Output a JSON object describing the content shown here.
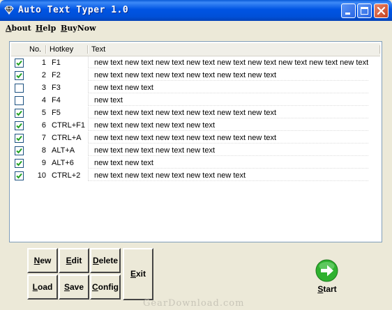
{
  "window": {
    "title": "Auto Text Typer 1.0"
  },
  "menu": [
    {
      "label": "About"
    },
    {
      "label": "Help"
    },
    {
      "label": "BuyNow"
    }
  ],
  "table": {
    "headers": {
      "no": "No.",
      "hotkey": "Hotkey",
      "text": "Text"
    },
    "rows": [
      {
        "checked": true,
        "no": "1",
        "hotkey": "F1",
        "text": "new text new text new text new text new text new text new text new text new text"
      },
      {
        "checked": true,
        "no": "2",
        "hotkey": "F2",
        "text": "new text new text new text new text new text new text"
      },
      {
        "checked": false,
        "no": "3",
        "hotkey": "F3",
        "text": "new text new text"
      },
      {
        "checked": false,
        "no": "4",
        "hotkey": "F4",
        "text": "new text"
      },
      {
        "checked": true,
        "no": "5",
        "hotkey": "F5",
        "text": "new text new text new text new text new text new text"
      },
      {
        "checked": true,
        "no": "6",
        "hotkey": "CTRL+F1",
        "text": "new text new text new text new text"
      },
      {
        "checked": true,
        "no": "7",
        "hotkey": "CTRL+A",
        "text": "new text new text new text new text new text new text"
      },
      {
        "checked": true,
        "no": "8",
        "hotkey": "ALT+A",
        "text": "new text new text new text new text"
      },
      {
        "checked": true,
        "no": "9",
        "hotkey": "ALT+6",
        "text": "new text new text"
      },
      {
        "checked": true,
        "no": "10",
        "hotkey": "CTRL+2",
        "text": "new text new text new text new text new text"
      }
    ]
  },
  "buttons": {
    "new": "New",
    "edit": "Edit",
    "delete": "Delete",
    "load": "Load",
    "save": "Save",
    "config": "Config",
    "exit": "Exit",
    "start": "Start"
  },
  "watermark": "GearDownload.com",
  "colors": {
    "titlebar": "#0054e3",
    "check": "#21a121",
    "start_icon": "#2fb12f"
  }
}
